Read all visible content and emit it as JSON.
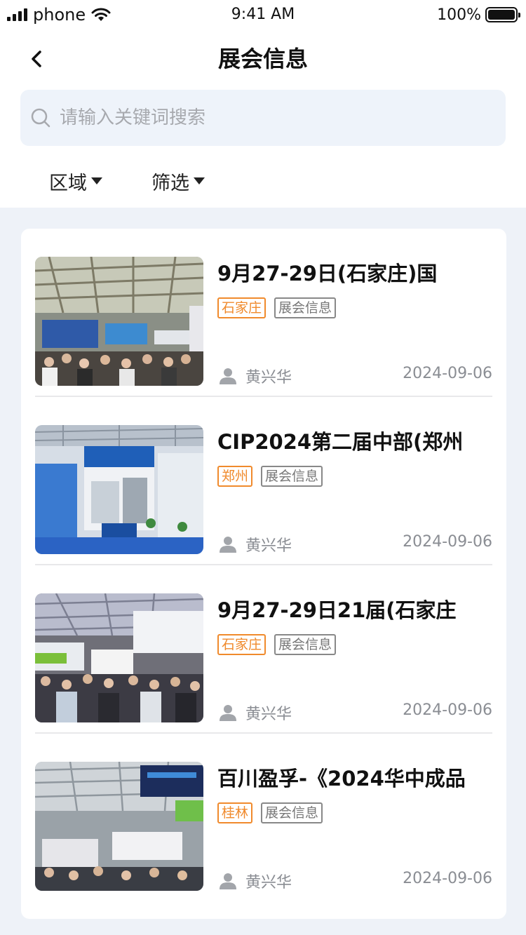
{
  "status_bar": {
    "carrier": "phone",
    "time": "9:41 AM",
    "battery": "100%"
  },
  "nav": {
    "title": "展会信息"
  },
  "search": {
    "placeholder": "请输入关键词搜索"
  },
  "filters": [
    {
      "label": "区域"
    },
    {
      "label": "筛选"
    }
  ],
  "items": [
    {
      "title": "9月27-29日(石家庄)国",
      "city_tag": "石家庄",
      "category_tag": "展会信息",
      "author": "黄兴华",
      "date": "2024-09-06"
    },
    {
      "title": "CIP2024第二届中部(郑州",
      "city_tag": "郑州",
      "category_tag": "展会信息",
      "author": "黄兴华",
      "date": "2024-09-06"
    },
    {
      "title": "9月27-29日21届(石家庄",
      "city_tag": "石家庄",
      "category_tag": "展会信息",
      "author": "黄兴华",
      "date": "2024-09-06"
    },
    {
      "title": "百川盈孚-《2024华中成品",
      "city_tag": "桂林",
      "category_tag": "展会信息",
      "author": "黄兴华",
      "date": "2024-09-06"
    }
  ],
  "colors": {
    "accent_tag": "#f08a2c",
    "page_bg": "#eef2f8",
    "search_bg": "#eef3fa"
  }
}
